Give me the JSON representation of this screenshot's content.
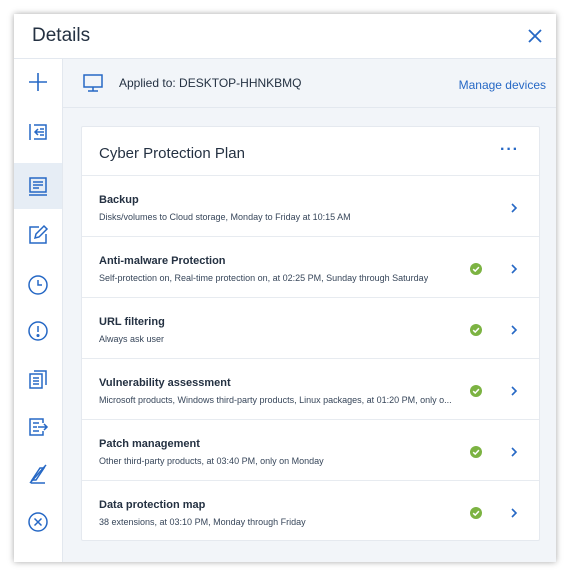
{
  "panel": {
    "title": "Details"
  },
  "device_bar": {
    "applied_label": "Applied to: DESKTOP-HHNKBMQ",
    "manage_label": "Manage devices"
  },
  "plan": {
    "title": "Cyber Protection Plan",
    "more_label": "···",
    "rows": [
      {
        "title": "Backup",
        "desc": "Disks/volumes to Cloud storage, Monday to Friday at 10:15 AM",
        "status": "none"
      },
      {
        "title": "Anti-malware Protection",
        "desc": "Self-protection on, Real-time protection on, at 02:25 PM, Sunday through Saturday",
        "status": "ok"
      },
      {
        "title": "URL filtering",
        "desc": "Always ask user",
        "status": "ok"
      },
      {
        "title": "Vulnerability assessment",
        "desc": "Microsoft products, Windows third-party products, Linux packages, at 01:20 PM, only o...",
        "status": "ok"
      },
      {
        "title": "Patch management",
        "desc": "Other third-party products, at 03:40 PM, only on Monday",
        "status": "ok"
      },
      {
        "title": "Data protection map",
        "desc": "38 extensions, at 03:10 PM, Monday through Friday",
        "status": "ok"
      }
    ]
  },
  "sidebar_icons": [
    "plus-icon",
    "import-icon",
    "plan-details-icon",
    "edit-icon",
    "clock-icon",
    "alert-icon",
    "copy-icon",
    "export-icon",
    "revoke-icon",
    "delete-icon"
  ],
  "colors": {
    "accent": "#2668c5",
    "ok_green": "#7cb342",
    "text": "#243142",
    "background": "#f2f5f9"
  }
}
